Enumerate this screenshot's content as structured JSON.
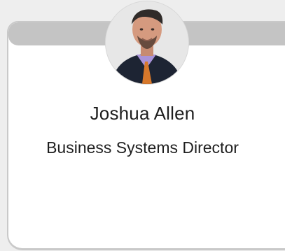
{
  "profile": {
    "name": "Joshua Allen",
    "title": "Business Systems Director"
  },
  "avatar": {
    "icon": "profile-photo",
    "background_color": "#e6e6e6"
  },
  "colors": {
    "header_band": "#c4c4c4",
    "card_border": "#c9c9c9",
    "text": "#1f1f1f"
  }
}
